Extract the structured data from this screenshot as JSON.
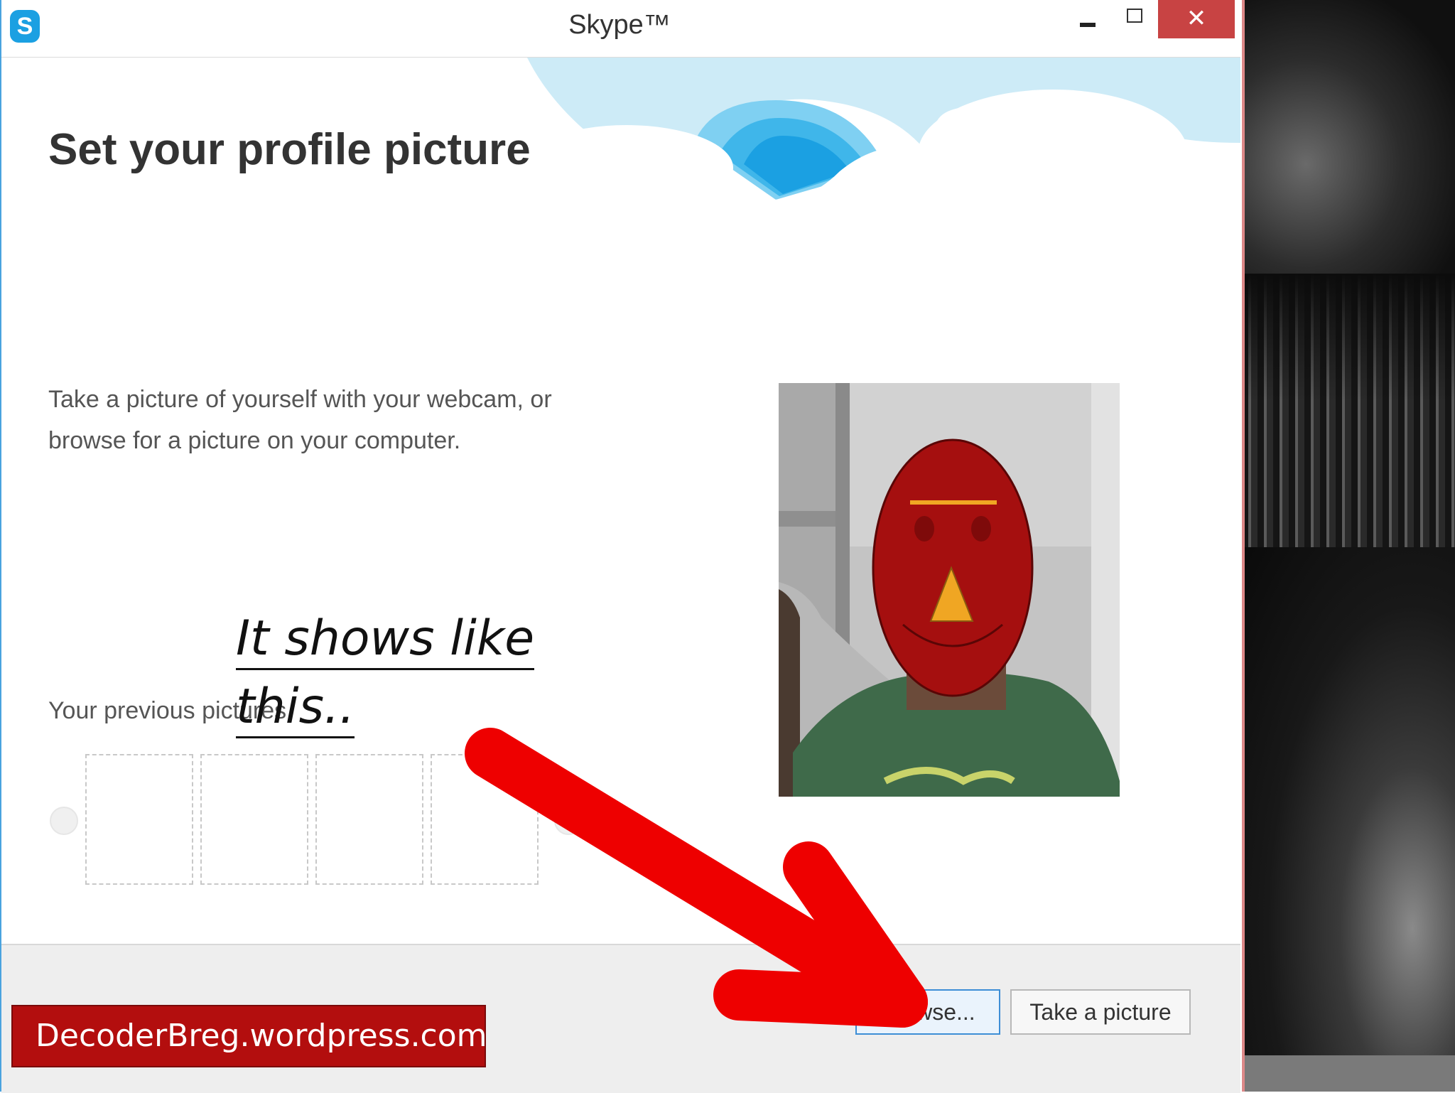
{
  "window": {
    "title": "Skype™",
    "app_icon_glyph": "S",
    "controls": {
      "minimize": "minimize-icon",
      "maximize": "maximize-icon",
      "close": "✕"
    }
  },
  "page": {
    "heading": "Set your profile picture",
    "intro_line1": "Take a picture of yourself with your webcam, or",
    "intro_line2": "browse for a picture on your computer.",
    "previous_label": "Your previous pictures",
    "thumbnail_count": 4
  },
  "buttons": {
    "browse": "Browse...",
    "take_picture": "Take a picture"
  },
  "annotation": {
    "line1": "It shows like",
    "line2": "this.."
  },
  "banner": {
    "text": "DecoderBreg.wordpress.com"
  },
  "colors": {
    "skype_blue": "#1ba0e2",
    "close_red": "#c84343",
    "arrow_red": "#ee0000",
    "banner_red": "#b30e0e",
    "face_red": "#a50f0f",
    "nose_orange": "#f0a623"
  }
}
